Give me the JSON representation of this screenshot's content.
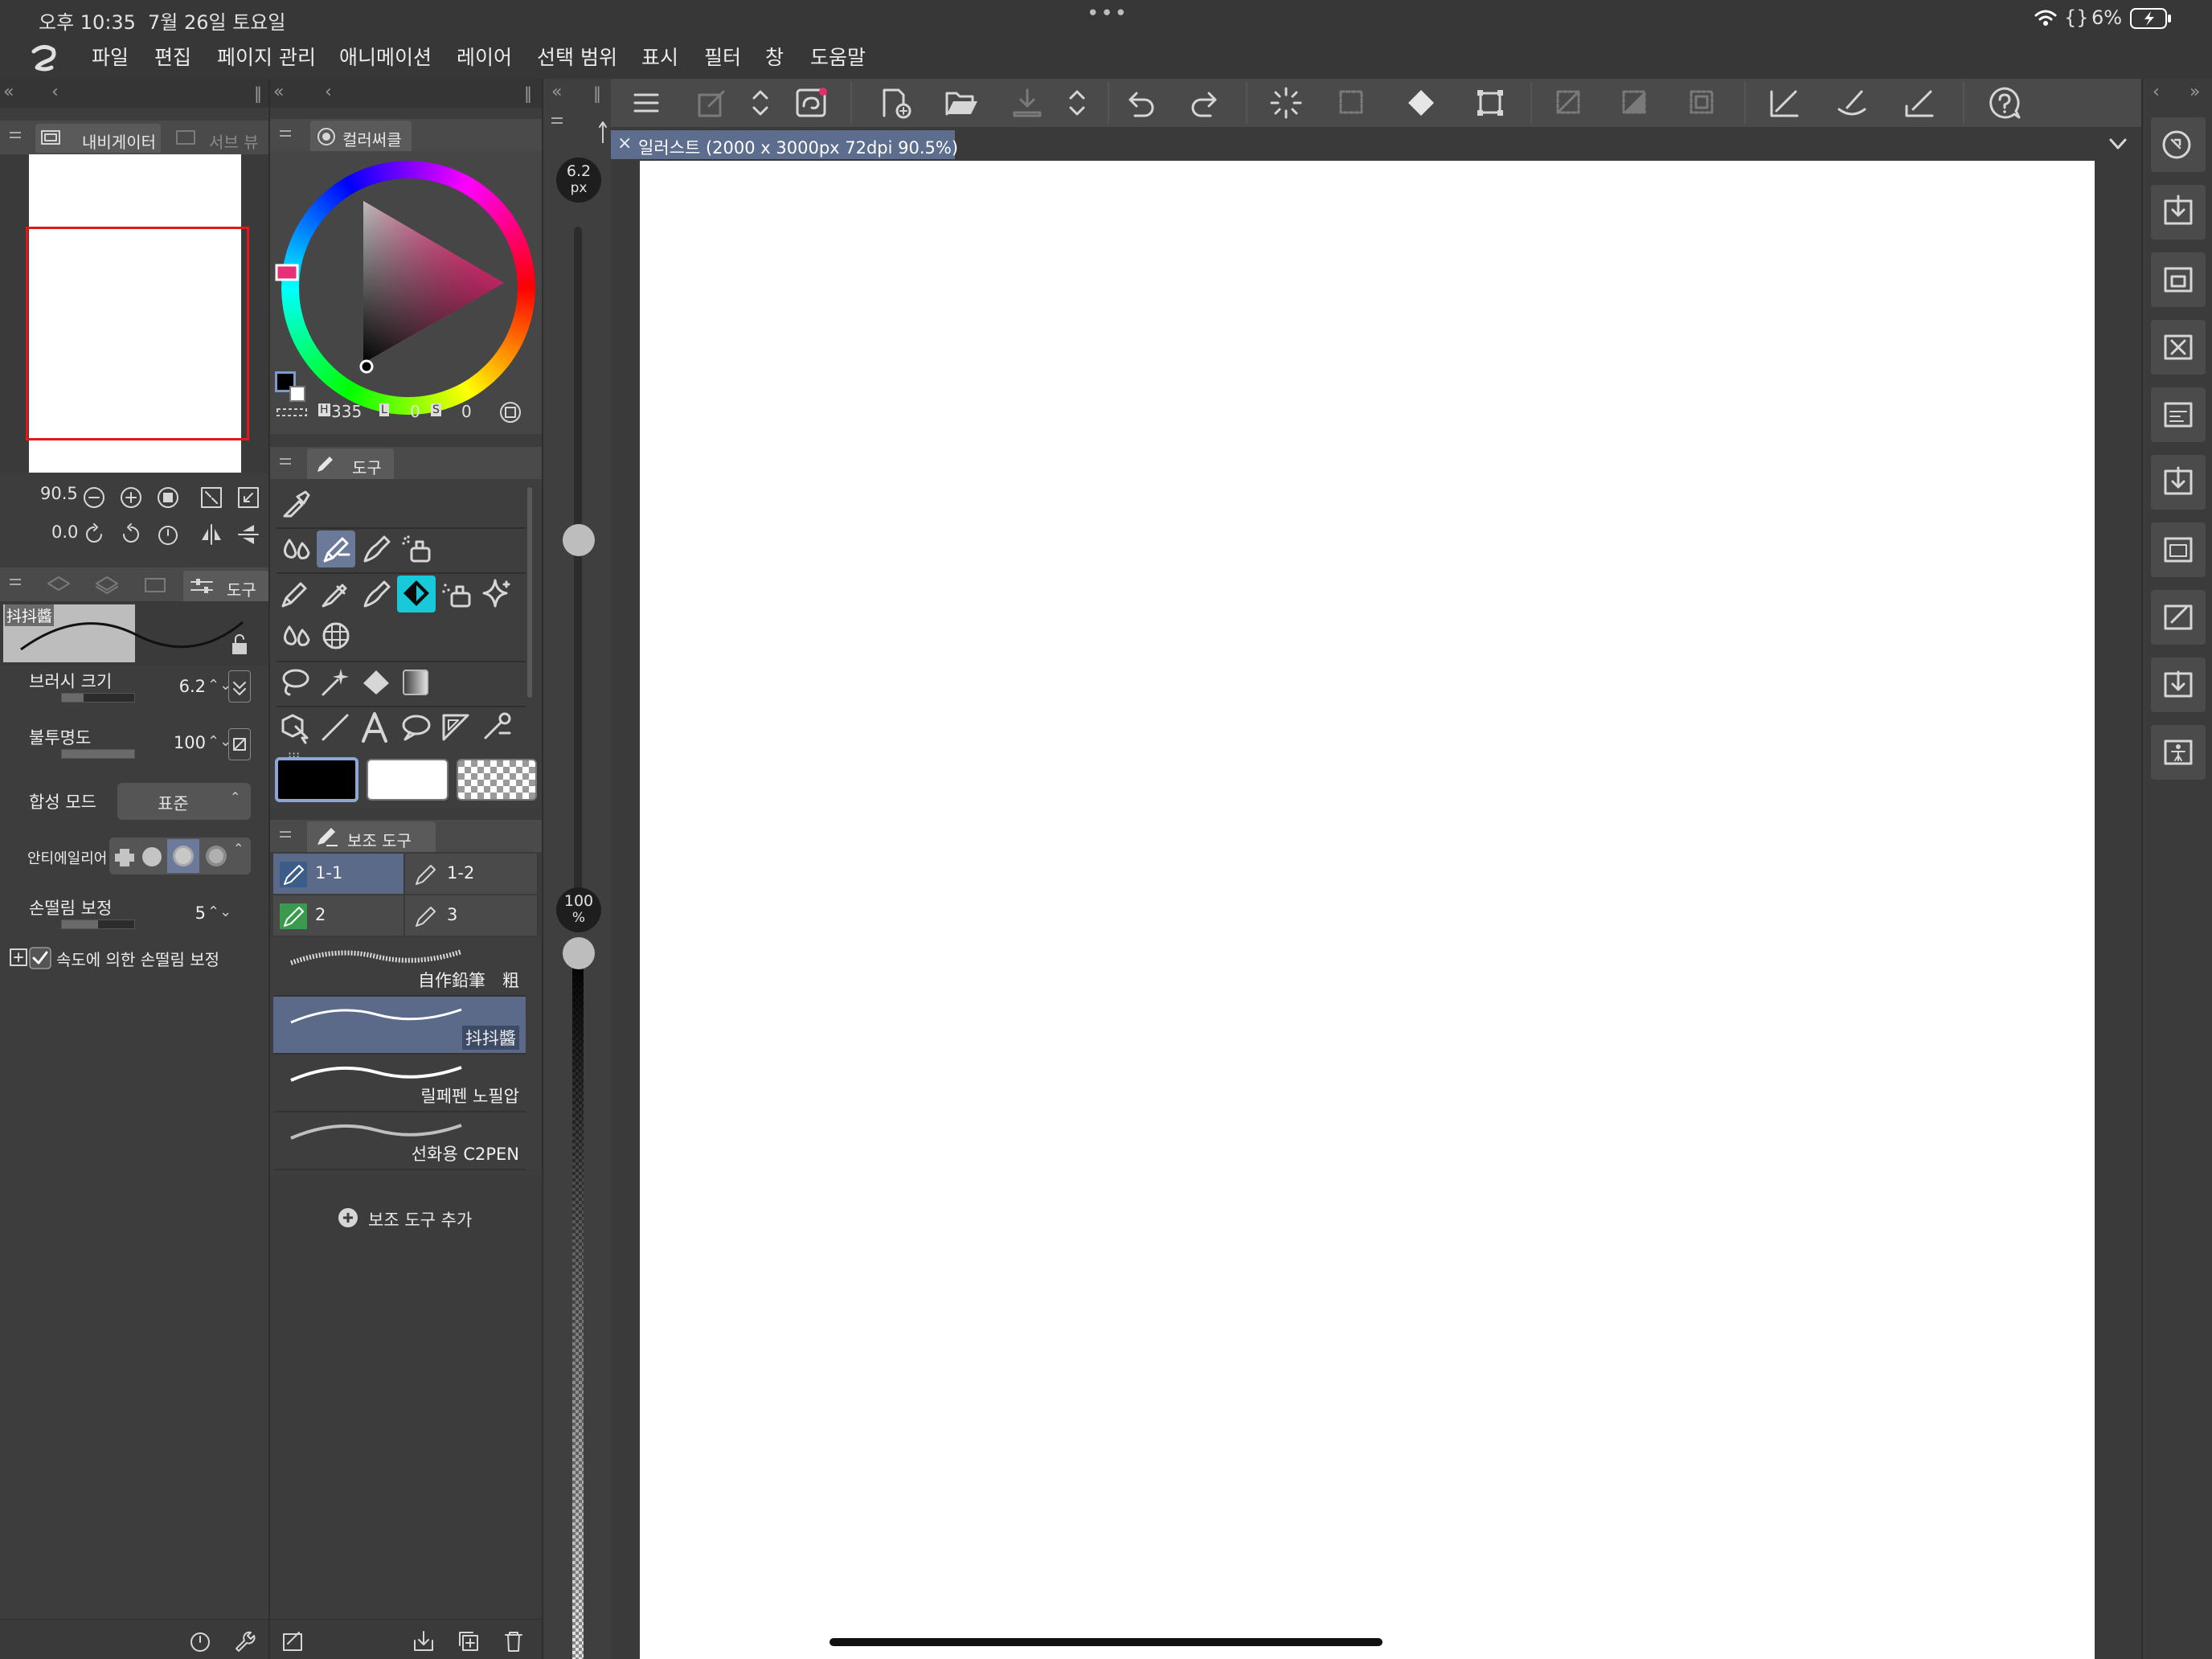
{
  "status": {
    "time": "오후 10:35",
    "date": "7월 26일 토요일",
    "dots": "•••",
    "extra": "{}",
    "battery": "6%"
  },
  "menu": {
    "items": [
      "파일",
      "편집",
      "페이지 관리",
      "애니메이션",
      "레이어",
      "선택 범위",
      "표시",
      "필터",
      "창",
      "도움말"
    ]
  },
  "navigator": {
    "tab_label": "내비게이터",
    "subview_label": "서브 뷰",
    "zoom_value": "90.5",
    "rotate_value": "0.0"
  },
  "tool_property": {
    "tab_label": "도구",
    "brush_name": "抖抖醬",
    "brush_size_label": "브러시 크기",
    "brush_size_value": "6.2",
    "brush_size_fraction": 0.3,
    "opacity_label": "불투명도",
    "opacity_value": "100",
    "opacity_fraction": 1.0,
    "blend_label": "합성 모드",
    "blend_value": "표준",
    "antialias_label": "안티에일리어",
    "stabilization_label": "손떨림 보정",
    "stabilization_value": "5",
    "stabilization_fraction": 0.5,
    "speed_stab_label": "속도에 의한 손떨림 보정",
    "speed_stab_checked": true
  },
  "color_wheel": {
    "tab_label": "컬러써클",
    "h_label": "H",
    "h_value": "335",
    "l_label": "L",
    "l_value": "0",
    "s_label": "S",
    "s_value": "0",
    "main_color": "#000000",
    "sub_color": "#ffffff",
    "hue_color": "#e8307a"
  },
  "tools": {
    "tab_label": "도구",
    "selected_tool": "pen",
    "highlight_color": "#18c9d9"
  },
  "sub_tools": {
    "tab_label": "보조 도구",
    "tabs": [
      "1-1",
      "1-2",
      "2",
      "3"
    ],
    "brushes": [
      "自作鉛筆　粗",
      "抖抖醬",
      "릴페펜 노필압",
      "선화용 C2PEN"
    ],
    "selected_brush": "抖抖醬",
    "add_label": "보조 도구 추가"
  },
  "size_slider": {
    "value": "6.2",
    "unit": "px",
    "level_fraction": 0.05
  },
  "opacity_slider": {
    "value": "100",
    "unit": "%",
    "level_fraction": 1.0
  },
  "canvas": {
    "tab_title": "일러스트 (2000 x 3000px 72dpi 90.5%)"
  }
}
